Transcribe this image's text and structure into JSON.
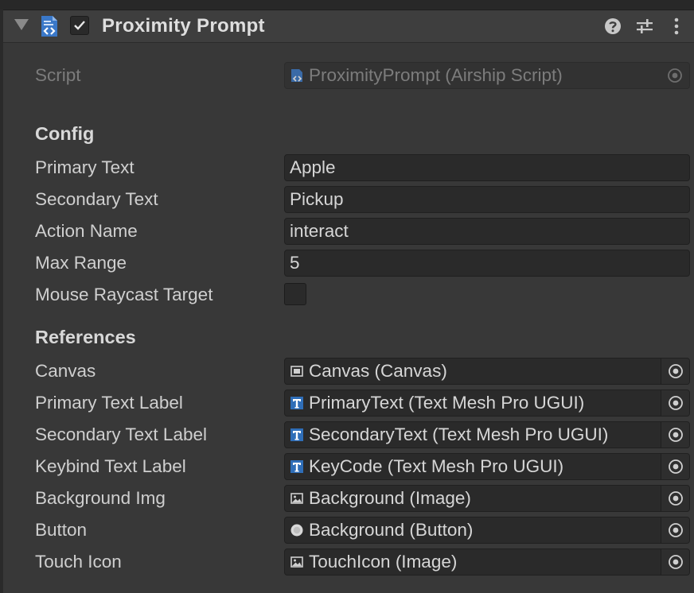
{
  "component": {
    "title": "Proximity Prompt",
    "enabled": true
  },
  "script_row": {
    "label": "Script",
    "value": "ProximityPrompt (Airship Script)"
  },
  "config": {
    "heading": "Config",
    "fields": [
      {
        "label": "Primary Text",
        "value": "Apple"
      },
      {
        "label": "Secondary Text",
        "value": "Pickup"
      },
      {
        "label": "Action Name",
        "value": "interact"
      },
      {
        "label": "Max Range",
        "value": "5"
      }
    ],
    "toggle": {
      "label": "Mouse Raycast Target",
      "checked": false
    }
  },
  "references": {
    "heading": "References",
    "fields": [
      {
        "label": "Canvas",
        "value": "Canvas (Canvas)",
        "icon": "canvas-icon"
      },
      {
        "label": "Primary Text Label",
        "value": "PrimaryText (Text Mesh Pro UGUI)",
        "icon": "text-mesh-pro-icon"
      },
      {
        "label": "Secondary Text Label",
        "value": "SecondaryText (Text Mesh Pro UGUI)",
        "icon": "text-mesh-pro-icon"
      },
      {
        "label": "Keybind Text Label",
        "value": "KeyCode (Text Mesh Pro UGUI)",
        "icon": "text-mesh-pro-icon"
      },
      {
        "label": "Background Img",
        "value": "Background (Image)",
        "icon": "image-icon"
      },
      {
        "label": "Button",
        "value": "Background (Button)",
        "icon": "button-icon"
      },
      {
        "label": "Touch Icon",
        "value": "TouchIcon (Image)",
        "icon": "image-icon"
      }
    ]
  }
}
